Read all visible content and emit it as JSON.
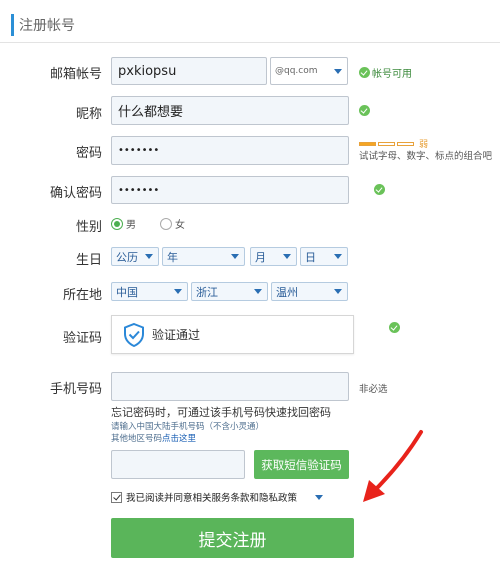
{
  "header": {
    "title": "注册帐号"
  },
  "email": {
    "label": "邮箱帐号",
    "value": "pxkiopsu",
    "domain": "@qq.com",
    "status": "帐号可用"
  },
  "nickname": {
    "label": "昵称",
    "value": "什么都想要"
  },
  "password": {
    "label": "密码",
    "value": "•••••••",
    "strength_text": "弱",
    "hint": "试试字母、数字、标点的组合吧"
  },
  "confirm_password": {
    "label": "确认密码",
    "value": "•••••••"
  },
  "gender": {
    "label": "性别",
    "options": [
      {
        "label": "男",
        "selected": true
      },
      {
        "label": "女",
        "selected": false
      }
    ]
  },
  "birthday": {
    "label": "生日",
    "calendar": "公历",
    "year": "年",
    "month": "月",
    "day": "日"
  },
  "location": {
    "label": "所在地",
    "country": "中国",
    "province": "浙江",
    "city": "温州"
  },
  "captcha": {
    "label": "验证码",
    "text": "验证通过"
  },
  "phone": {
    "label": "手机号码",
    "value": "",
    "optional": "非必选",
    "note": "忘记密码时，可通过该手机号码快速找回密码",
    "hint1": "请输入中国大陆手机号码（不含小灵通）",
    "hint2_prefix": "其他地区号码",
    "hint2_link": "点击这里"
  },
  "sms": {
    "value": "",
    "button": "获取短信验证码"
  },
  "agreement": {
    "text": "我已阅读并同意相关服务条款和隐私政策",
    "checked": true
  },
  "submit": {
    "label": "提交注册"
  },
  "colors": {
    "accent_green": "#5cb85c",
    "ok_green": "#6ac259",
    "annotation_red": "#e8231b"
  }
}
